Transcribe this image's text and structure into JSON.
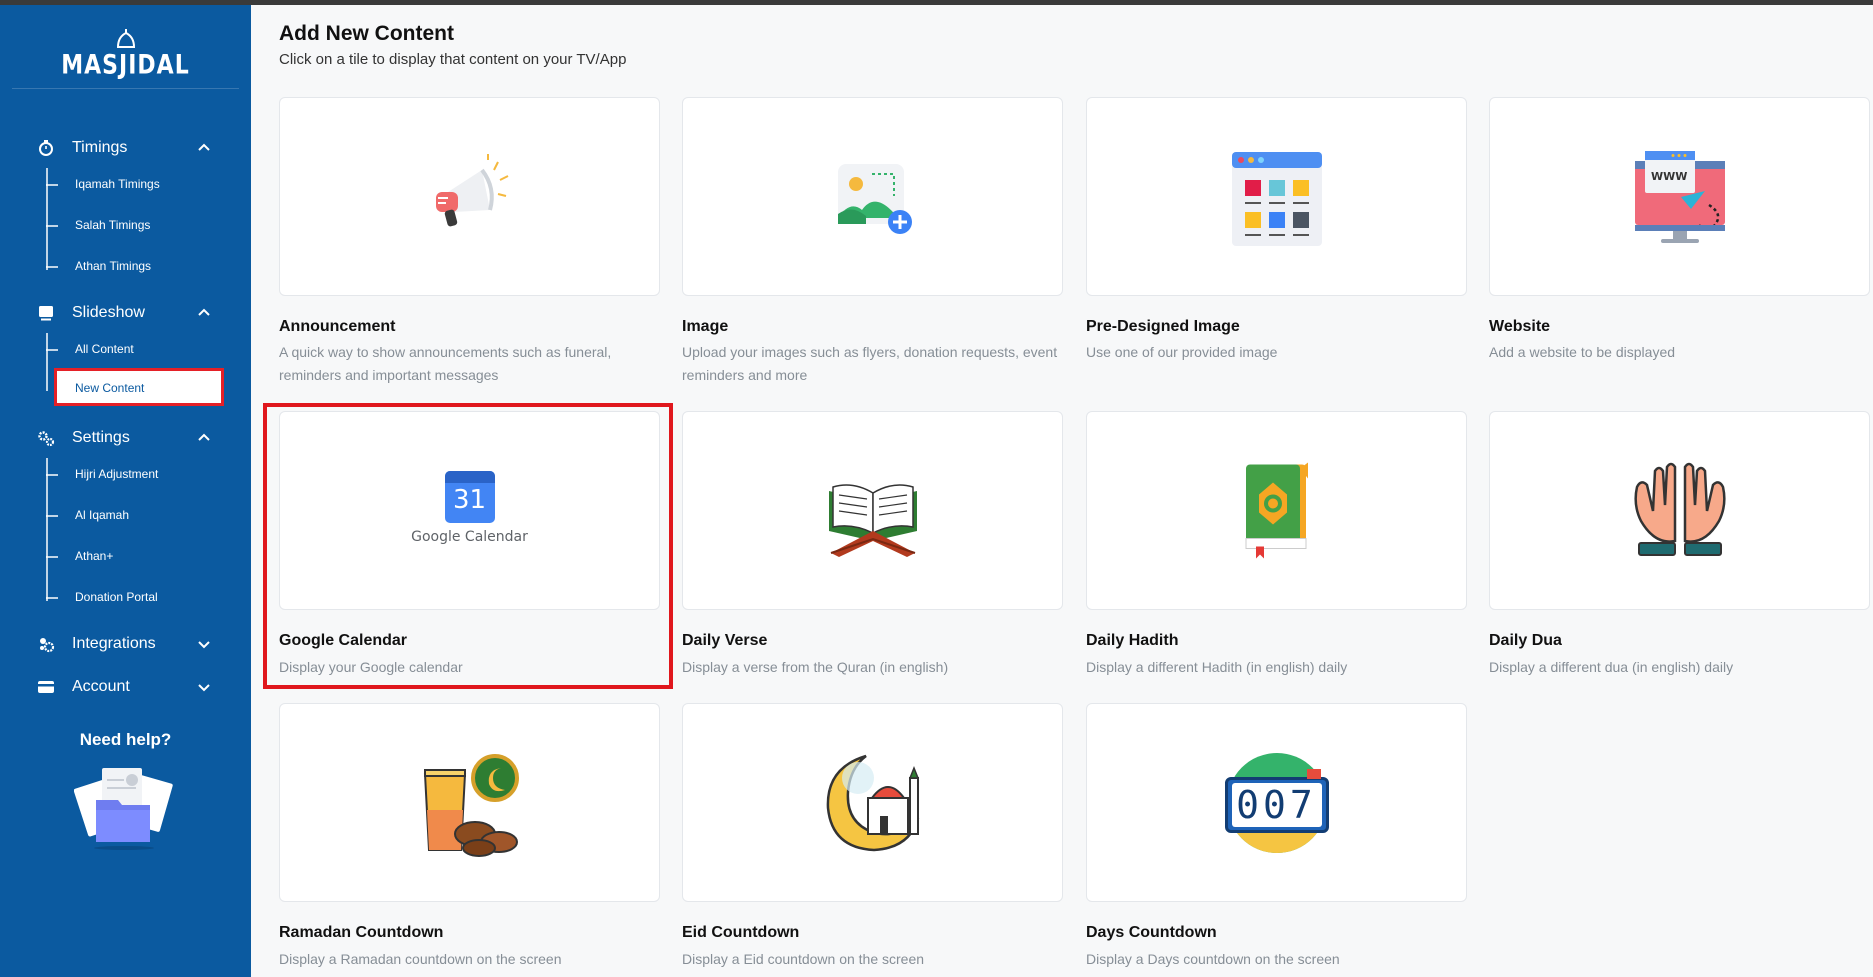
{
  "app": {
    "brand": "MASJIDAL"
  },
  "sidebar": {
    "sections": [
      {
        "label": "Timings",
        "icon": "clock-icon",
        "expanded": true,
        "items": [
          {
            "label": "Iqamah Timings"
          },
          {
            "label": "Salah Timings"
          },
          {
            "label": "Athan Timings"
          }
        ]
      },
      {
        "label": "Slideshow",
        "icon": "slideshow-icon",
        "expanded": true,
        "items": [
          {
            "label": "All Content"
          },
          {
            "label": "New Content",
            "active": true
          }
        ]
      },
      {
        "label": "Settings",
        "icon": "gears-icon",
        "expanded": true,
        "items": [
          {
            "label": "Hijri Adjustment"
          },
          {
            "label": "Al Iqamah"
          },
          {
            "label": "Athan+"
          },
          {
            "label": "Donation Portal"
          }
        ]
      },
      {
        "label": "Integrations",
        "icon": "integrations-icon",
        "expanded": false,
        "items": []
      },
      {
        "label": "Account",
        "icon": "card-icon",
        "expanded": false,
        "items": []
      }
    ],
    "help": {
      "title": "Need help?"
    }
  },
  "main": {
    "title": "Add New Content",
    "subtitle": "Click on a tile to display that content on your TV/App",
    "tiles": [
      {
        "title": "Announcement",
        "description": "A quick way to show announcements such as funeral, reminders and important messages",
        "icon": "megaphone-icon"
      },
      {
        "title": "Image",
        "description": "Upload your images such as flyers, donation requests, event reminders and more",
        "icon": "image-add-icon"
      },
      {
        "title": "Pre-Designed Image",
        "description": "Use one of our provided image",
        "icon": "template-grid-icon"
      },
      {
        "title": "Website",
        "description": "Add a website to be displayed",
        "icon": "website-monitor-icon"
      },
      {
        "title": "Google Calendar",
        "description": "Display your Google calendar",
        "icon": "google-calendar-icon",
        "logo_number": "31",
        "logo_text": "Google Calendar"
      },
      {
        "title": "Daily Verse",
        "description": "Display a verse from the Quran (in english)",
        "icon": "quran-stand-icon"
      },
      {
        "title": "Daily Hadith",
        "description": "Display a different Hadith (in english) daily",
        "icon": "hadith-book-icon"
      },
      {
        "title": "Daily Dua",
        "description": "Display a different dua (in english) daily",
        "icon": "praying-hands-icon"
      },
      {
        "title": "Ramadan Countdown",
        "description": "Display a Ramadan countdown on the screen",
        "icon": "ramadan-iftar-icon"
      },
      {
        "title": "Eid Countdown",
        "description": "Display a Eid countdown on the screen",
        "icon": "crescent-mosque-icon"
      },
      {
        "title": "Days Countdown",
        "description": "Display a Days countdown on the screen",
        "icon": "flip-counter-icon",
        "counter_digits": "007"
      }
    ]
  },
  "colors": {
    "sidebar": "#0b5aa0",
    "highlight": "#e0171d"
  }
}
